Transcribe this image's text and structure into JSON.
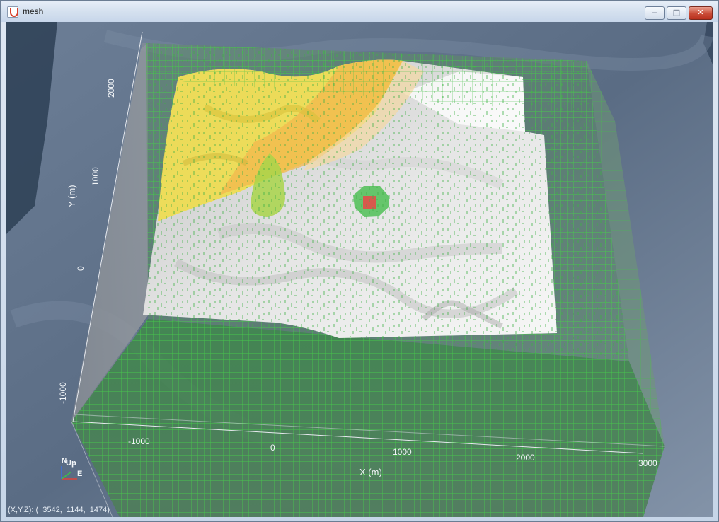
{
  "window": {
    "title": "mesh"
  },
  "controls": {
    "minimize": "‒",
    "maximize": "□",
    "close": "✕"
  },
  "axes": {
    "x_title": "X (m)",
    "y_title": "Y (m)",
    "x_ticks": [
      "-1000",
      "0",
      "1000",
      "2000",
      "3000"
    ],
    "y_ticks": [
      "-1000",
      "0",
      "1000",
      "2000"
    ]
  },
  "orientation": {
    "up": "Up",
    "east": "E",
    "north": "N"
  },
  "status": {
    "coords": "(X,Y,Z): (  3542,  1144,  1474)"
  },
  "colors": {
    "terrain": "#5a6d86",
    "mesh": "#49d24b",
    "surface": "#f2f2f2",
    "yellow_zone": "#f1dd4a",
    "orange_zone": "#f2b54b",
    "plume": "#a8d34b",
    "marker": "#d85a4e"
  }
}
